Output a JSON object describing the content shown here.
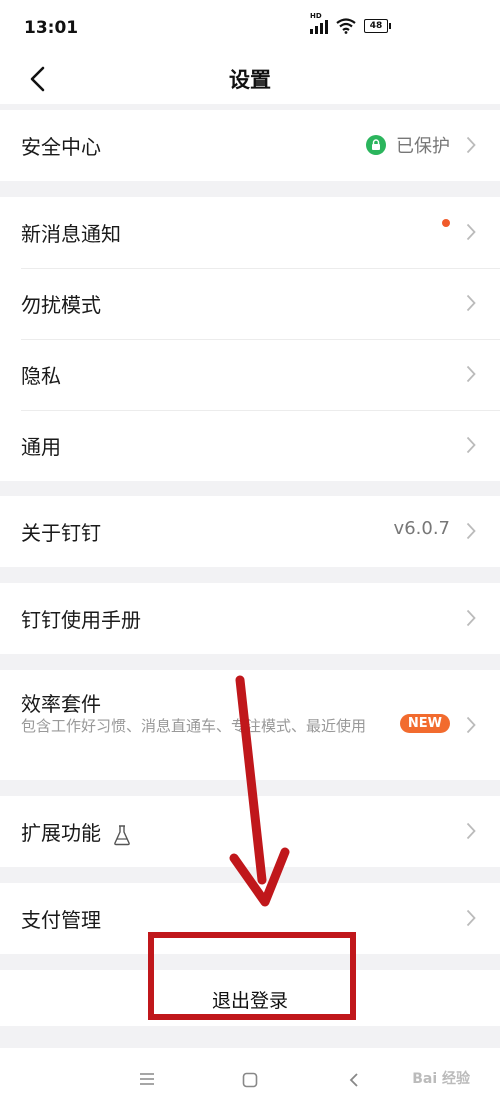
{
  "status": {
    "time": "13:01",
    "hd": "HD",
    "battery": "48"
  },
  "nav": {
    "title": "设置"
  },
  "groups": {
    "security": {
      "label": "安全中心",
      "status": "已保护"
    },
    "notifications": {
      "label": "新消息通知"
    },
    "dnd": {
      "label": "勿扰模式"
    },
    "privacy": {
      "label": "隐私"
    },
    "general": {
      "label": "通用"
    },
    "about": {
      "label": "关于钉钉",
      "version": "v6.0.7"
    },
    "manual": {
      "label": "钉钉使用手册"
    },
    "efficiency": {
      "label": "效率套件",
      "desc": "包含工作好习惯、消息直通车、专注模式、最近使用",
      "badge": "NEW"
    },
    "extensions": {
      "label": "扩展功能"
    },
    "payment": {
      "label": "支付管理"
    }
  },
  "logout": {
    "label": "退出登录"
  },
  "watermark": "Bai 经验",
  "colors": {
    "accent_red": "#c0171b",
    "green": "#2bb55d",
    "orange": "#f26b2e"
  }
}
